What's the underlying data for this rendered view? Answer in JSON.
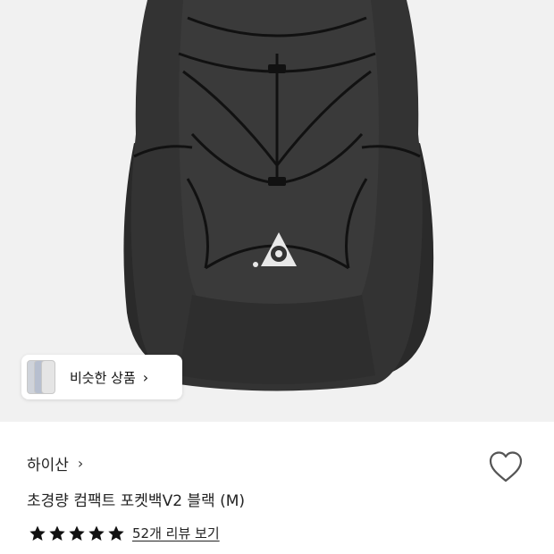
{
  "hero": {
    "image_subject": "black-backpack-photo",
    "bg_color": "#f1f1f1"
  },
  "similar": {
    "label": "비슷한 상품",
    "chevron": "›"
  },
  "product": {
    "brand": "하이산",
    "brand_chevron": "›",
    "title": "초경량 컴팩트 포켓백V2 블랙 (M)",
    "rating": 5,
    "rating_max": 5,
    "review_link": "52개 리뷰 보기"
  },
  "icons": {
    "wishlist": "heart-icon",
    "star": "star-icon"
  }
}
